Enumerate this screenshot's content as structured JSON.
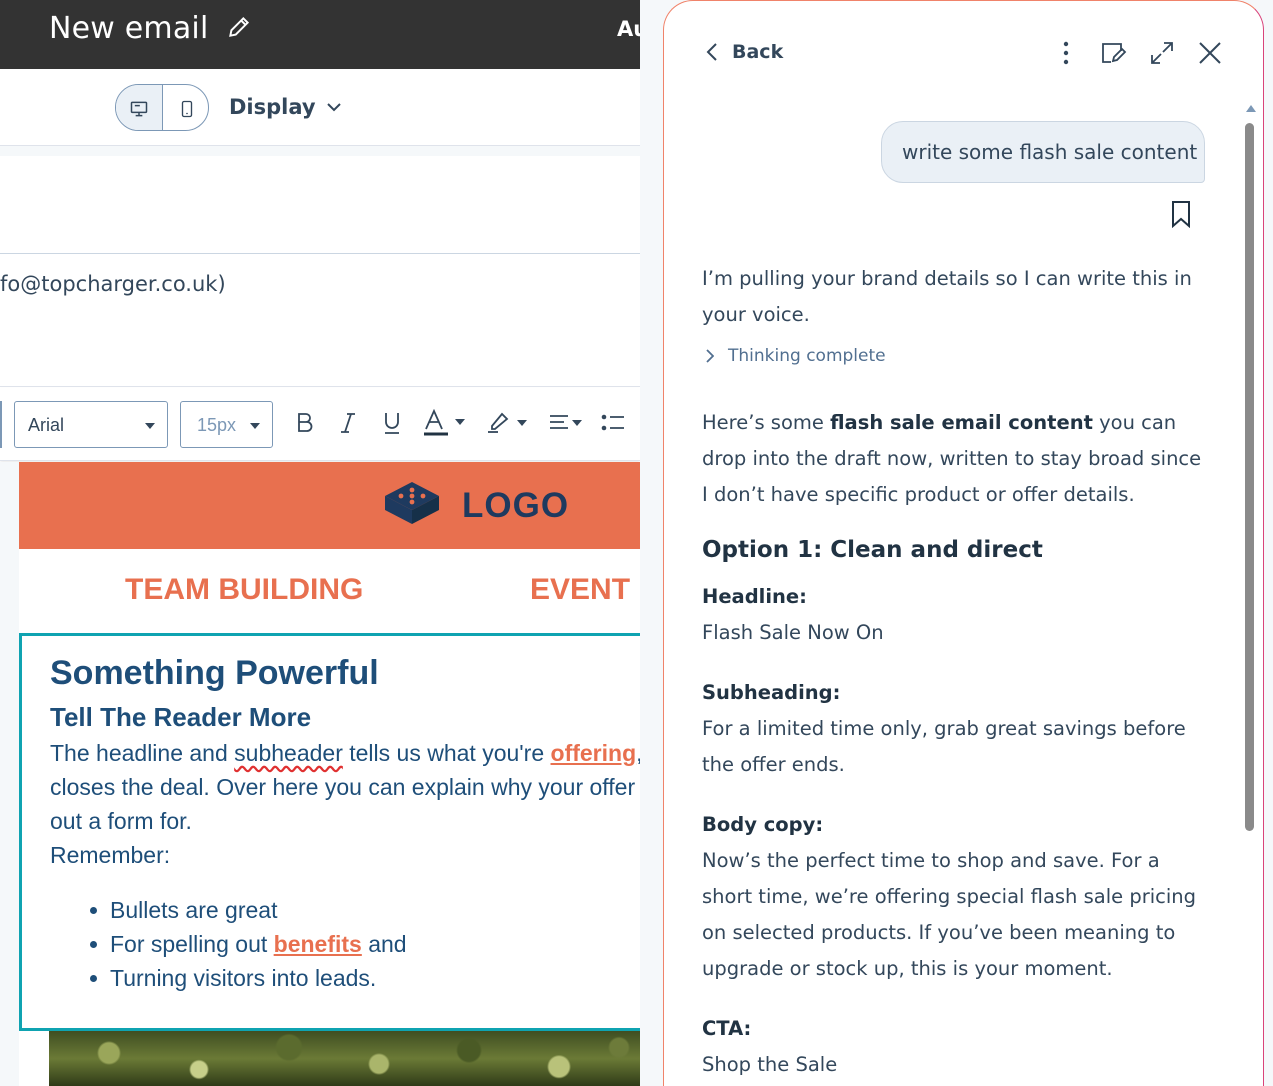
{
  "editor": {
    "title": "New email",
    "topbar_right_text": "Au",
    "display_label": "Display",
    "from_text": "fo@topcharger.co.uk)",
    "toolbar": {
      "font": "Arial",
      "size": "15px"
    }
  },
  "email": {
    "logo_text": "LOGO",
    "nav": [
      "TEAM BUILDING",
      "EVENT"
    ],
    "heading": "Something Powerful",
    "subheading": "Tell The Reader More",
    "para_line1_a": "The headline and ",
    "para_line1_spell": "subheader",
    "para_line1_b": " tells us what you're ",
    "para_line1_link": "offering",
    "para_line1_c": ", a",
    "para_line2": "closes the deal. Over here you can explain why your offer is",
    "para_line3": "out a form for.",
    "para_line4": "Remember:",
    "bullet1": "Bullets are great",
    "bullet2_a": "For spelling out ",
    "bullet2_link": "benefits",
    "bullet2_b": " and",
    "bullet3": "Turning visitors into leads."
  },
  "panel": {
    "back_label": "Back",
    "user_message": "write some flash sale content",
    "reply1_line1": "I’m pulling your brand details so I can write this in",
    "reply1_line2": "your voice.",
    "thinking": "Thinking complete",
    "intro_a": "Here’s some ",
    "intro_bold": "flash sale email content",
    "intro_b": " you can",
    "intro_line2": "drop into the draft now, written to stay broad since",
    "intro_line3": "I don’t have specific product or offer details.",
    "option_heading": "Option 1: Clean and direct",
    "headline_label": "Headline:",
    "headline_value": "Flash Sale Now On",
    "subheading_label": "Subheading:",
    "subheading_line1": "For a limited time only, grab great savings before",
    "subheading_line2": "the offer ends.",
    "body_label": "Body copy:",
    "body_line1": "Now’s the perfect time to shop and save. For a",
    "body_line2": "short time, we’re offering special flash sale pricing",
    "body_line3": "on selected products. If you’ve been meaning to",
    "body_line4": "upgrade or stock up, this is your moment.",
    "cta_label": "CTA:",
    "cta_value": "Shop the Sale"
  },
  "colors": {
    "topbar": "#333333",
    "brand_orange": "#e8704f",
    "heading_blue": "#1e4e79",
    "selection_teal": "#0fa3b1"
  }
}
